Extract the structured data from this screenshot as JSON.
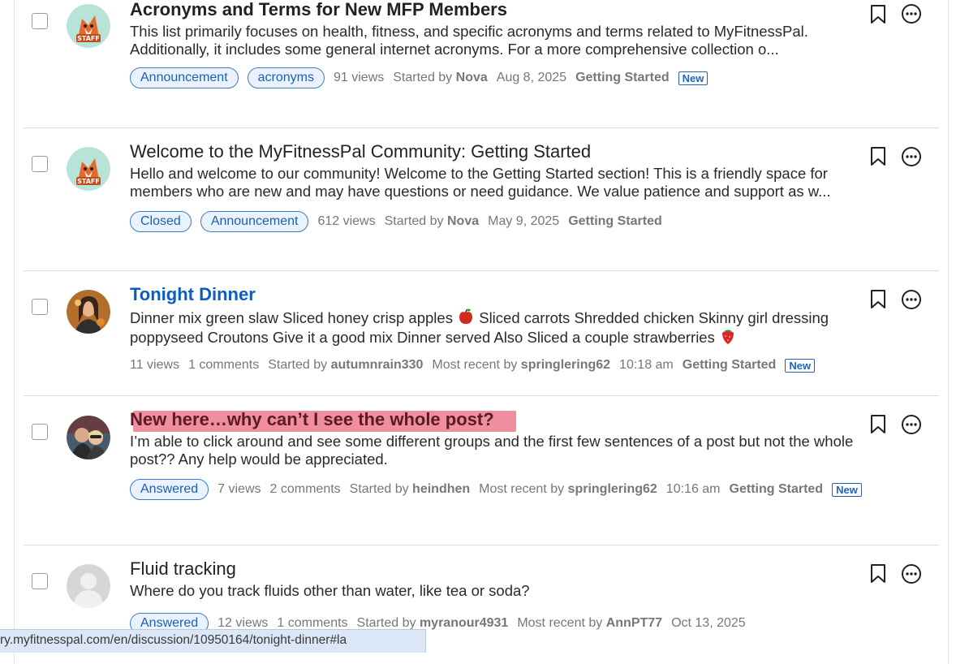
{
  "discussions": [
    {
      "title": "Acronyms and Terms for New MFP Members",
      "excerpt": "This list primarily focuses on health, fitness, and specific acronyms and terms related to MyFitnessPal. Additionally, it includes some general internet acronyms. For a more comprehensive collection o...",
      "tags": [
        "Announcement",
        "acronyms"
      ],
      "views": "91 views",
      "started_by_label": "Started by",
      "started_by": "Nova",
      "date": "Aug 8, 2025",
      "category": "Getting Started",
      "badge": "New",
      "avatar": "staff-fox-avatar"
    },
    {
      "title": "Welcome to the MyFitnessPal Community: Getting Started",
      "excerpt": "Hello and welcome to our community! Welcome to the Getting Started section! This is a friendly space for members who are new and may have questions or need guidance. We value patience and support as w...",
      "tags": [
        "Closed",
        "Announcement"
      ],
      "views": "612 views",
      "started_by_label": "Started by",
      "started_by": "Nova",
      "date": "May 9, 2025",
      "category": "Getting Started",
      "avatar": "staff-fox-avatar"
    },
    {
      "title": "Tonight Dinner",
      "excerpt_line1": "Dinner mix green slaw Sliced honey crisp apples",
      "excerpt_line1b": "Sliced carrots Shredded chicken Skinny girl",
      "excerpt_line2": "dressing poppyseed Croutons Give it a good mix Dinner served Also Sliced a couple strawberries",
      "views": "11 views",
      "comments": "1 comments",
      "started_by_label": "Started by",
      "started_by": "autumnrain330",
      "recent_label": "Most recent by",
      "recent_by": "springlering62",
      "time": "10:18 am",
      "category": "Getting Started",
      "badge": "New",
      "avatar": "user-photo-avatar"
    },
    {
      "title": "New here…why can’t I see the whole post?",
      "excerpt": "I’m able to click around and see some different groups and the first few sentences of a post but not the whole post?? Any help would be appreciated.",
      "tags": [
        "Answered"
      ],
      "views": "7 views",
      "comments": "2 comments",
      "started_by_label": "Started by",
      "started_by": "heindhen",
      "recent_label": "Most recent by",
      "recent_by": "springlering62",
      "time": "10:16 am",
      "category": "Getting Started",
      "badge": "New",
      "avatar": "user-photo-avatar"
    },
    {
      "title": "Fluid tracking",
      "excerpt": "Where do you track fluids other than water, like tea or soda?",
      "tags": [
        "Answered"
      ],
      "views": "12 views",
      "comments": "1 comments",
      "started_by_label": "Started by",
      "started_by": "myranour4931",
      "recent_label": "Most recent by",
      "recent_by": "AnnPT77",
      "date": "Oct 13, 2025",
      "avatar": "default-user-avatar"
    }
  ],
  "status_bar_url": "ry.myfitnesspal.com/en/discussion/10950164/tonight-dinner#la",
  "colors": {
    "link": "#0a5dc2",
    "tag_border": "#3b7bc8",
    "highlight": "#e96a7c"
  }
}
